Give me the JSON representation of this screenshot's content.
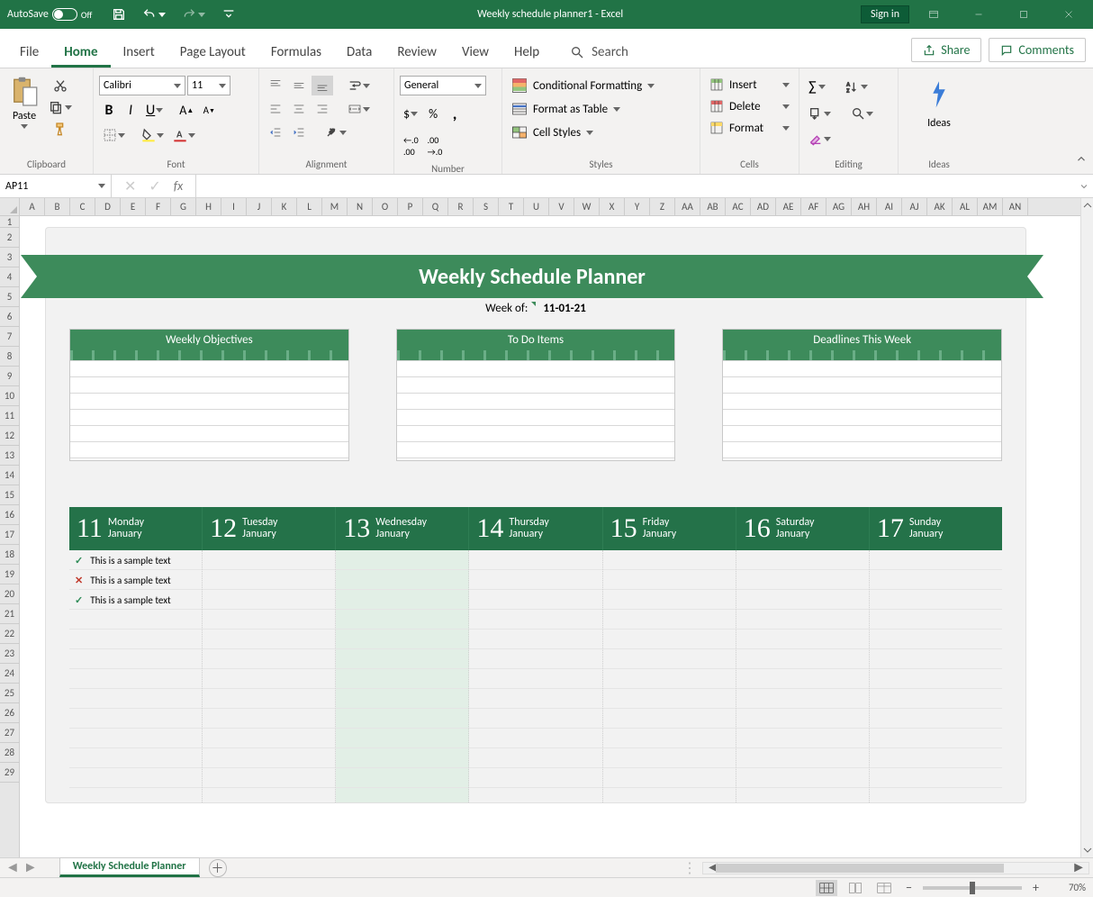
{
  "titlebar": {
    "autosave_label": "AutoSave",
    "autosave_state": "Off",
    "doc_title": "Weekly schedule planner1  -  Excel",
    "signin": "Sign in"
  },
  "menu": {
    "tabs": [
      "File",
      "Home",
      "Insert",
      "Page Layout",
      "Formulas",
      "Data",
      "Review",
      "View",
      "Help"
    ],
    "active": "Home",
    "search": "Search",
    "share": "Share",
    "comments": "Comments"
  },
  "ribbon": {
    "clipboard": {
      "paste": "Paste",
      "label": "Clipboard"
    },
    "font": {
      "name": "Calibri",
      "size": "11",
      "label": "Font"
    },
    "alignment": {
      "label": "Alignment"
    },
    "number": {
      "format": "General",
      "label": "Number"
    },
    "styles": {
      "cond": "Conditional Formatting",
      "table": "Format as Table",
      "cell": "Cell Styles",
      "label": "Styles"
    },
    "cells": {
      "insert": "Insert",
      "delete": "Delete",
      "format": "Format",
      "label": "Cells"
    },
    "editing": {
      "label": "Editing"
    },
    "ideas": {
      "label": "Ideas",
      "title": "Ideas"
    }
  },
  "formula_bar": {
    "namebox": "AP11"
  },
  "columns": [
    "A",
    "B",
    "C",
    "D",
    "E",
    "F",
    "G",
    "H",
    "I",
    "J",
    "K",
    "L",
    "M",
    "N",
    "O",
    "P",
    "Q",
    "R",
    "S",
    "T",
    "U",
    "V",
    "W",
    "X",
    "Y",
    "Z",
    "AA",
    "AB",
    "AC",
    "AD",
    "AE",
    "AF",
    "AG",
    "AH",
    "AI",
    "AJ",
    "AK",
    "AL",
    "AM",
    "AN"
  ],
  "rows": [
    "1",
    "2",
    "3",
    "4",
    "5",
    "6",
    "7",
    "8",
    "9",
    "10",
    "11",
    "12",
    "13",
    "14",
    "15",
    "16",
    "17",
    "18",
    "19",
    "20",
    "21",
    "22",
    "23",
    "24",
    "25",
    "26",
    "27",
    "28",
    "29"
  ],
  "planner": {
    "title": "Weekly Schedule Planner",
    "weekof_label": "Week of:",
    "weekof_date": "11-01-21",
    "cards": [
      "Weekly Objectives",
      "To Do Items",
      "Deadlines This Week"
    ],
    "days": [
      {
        "num": "11",
        "dow": "Monday",
        "mon": "January"
      },
      {
        "num": "12",
        "dow": "Tuesday",
        "mon": "January"
      },
      {
        "num": "13",
        "dow": "Wednesday",
        "mon": "January"
      },
      {
        "num": "14",
        "dow": "Thursday",
        "mon": "January"
      },
      {
        "num": "15",
        "dow": "Friday",
        "mon": "January"
      },
      {
        "num": "16",
        "dow": "Saturday",
        "mon": "January"
      },
      {
        "num": "17",
        "dow": "Sunday",
        "mon": "January"
      }
    ],
    "tasks": [
      {
        "status": "done",
        "text": "This is a sample text"
      },
      {
        "status": "not",
        "text": "This is a sample text"
      },
      {
        "status": "done",
        "text": "This is a sample text"
      }
    ]
  },
  "sheettab": "Weekly Schedule Planner",
  "zoom": "70%"
}
